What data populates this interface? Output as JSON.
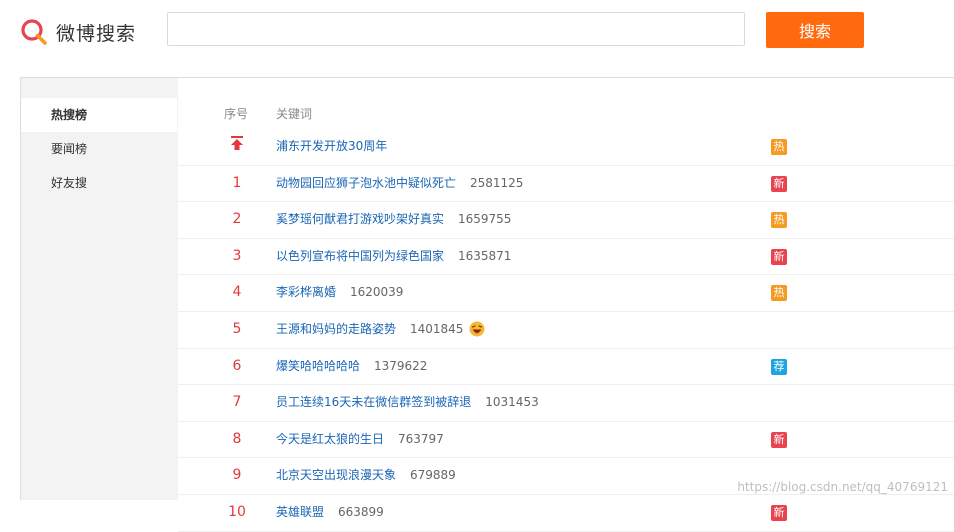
{
  "header": {
    "logo_text": "微博搜索",
    "search_placeholder": "",
    "search_button_label": "搜索"
  },
  "sidebar": {
    "items": [
      {
        "label": "热搜榜",
        "active": true
      },
      {
        "label": "要闻榜",
        "active": false
      },
      {
        "label": "好友搜",
        "active": false
      }
    ]
  },
  "table": {
    "headers": {
      "rank": "序号",
      "keyword": "关键词"
    },
    "rows": [
      {
        "rank": "",
        "top": true,
        "keyword": "浦东开发开放30周年",
        "count": "",
        "badge": "热",
        "badge_type": "hot",
        "emoji": false
      },
      {
        "rank": "1",
        "keyword": "动物园回应狮子泡水池中疑似死亡",
        "count": "2581125",
        "badge": "新",
        "badge_type": "new",
        "emoji": false
      },
      {
        "rank": "2",
        "keyword": "奚梦瑶何猷君打游戏吵架好真实",
        "count": "1659755",
        "badge": "热",
        "badge_type": "hot",
        "emoji": false
      },
      {
        "rank": "3",
        "keyword": "以色列宣布将中国列为绿色国家",
        "count": "1635871",
        "badge": "新",
        "badge_type": "new",
        "emoji": false
      },
      {
        "rank": "4",
        "keyword": "李彩桦离婚",
        "count": "1620039",
        "badge": "热",
        "badge_type": "hot",
        "emoji": false
      },
      {
        "rank": "5",
        "keyword": "王源和妈妈的走路姿势",
        "count": "1401845",
        "badge": "",
        "badge_type": "",
        "emoji": true
      },
      {
        "rank": "6",
        "keyword": "爆笑哈哈哈哈哈",
        "count": "1379622",
        "badge": "荐",
        "badge_type": "rec",
        "emoji": false
      },
      {
        "rank": "7",
        "keyword": "员工连续16天未在微信群签到被辞退",
        "count": "1031453",
        "badge": "",
        "badge_type": "",
        "emoji": false
      },
      {
        "rank": "8",
        "keyword": "今天是红太狼的生日",
        "count": "763797",
        "badge": "新",
        "badge_type": "new",
        "emoji": false
      },
      {
        "rank": "9",
        "keyword": "北京天空出现浪漫天象",
        "count": "679889",
        "badge": "",
        "badge_type": "",
        "emoji": false
      },
      {
        "rank": "10",
        "keyword": "英雄联盟",
        "count": "663899",
        "badge": "新",
        "badge_type": "new",
        "emoji": false
      }
    ]
  },
  "watermark": "https://blog.csdn.net/qq_40769121",
  "colors": {
    "accent": "#ff6a0e",
    "rank": "#e4393c",
    "link": "#1b66b5",
    "hot": "#f59a23",
    "new": "#e8434f",
    "rec": "#1ea5de"
  }
}
